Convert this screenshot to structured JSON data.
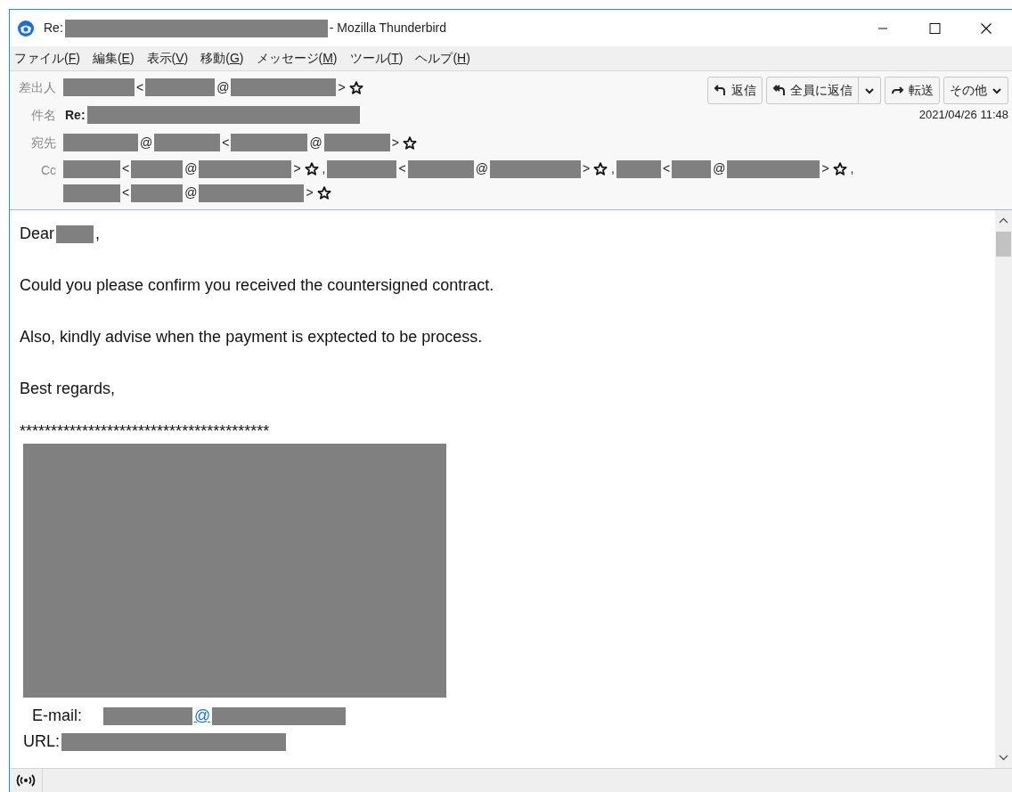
{
  "window": {
    "title": [
      {
        "kind": "text",
        "text": "Re:"
      },
      {
        "kind": "redacted"
      },
      {
        "kind": "text",
        "text": "- Mozilla Thunderbird"
      }
    ]
  },
  "menu": [
    {
      "before": "ファイル(",
      "accesskey": "F",
      "after": ")"
    },
    {
      "before": "編集(",
      "accesskey": "E",
      "after": ")"
    },
    {
      "before": "表示(",
      "accesskey": "V",
      "after": ")"
    },
    {
      "before": "移動(",
      "accesskey": "G",
      "after": ")"
    },
    {
      "before": "メッセージ(",
      "accesskey": "M",
      "after": ")"
    },
    {
      "before": "ツール(",
      "accesskey": "T",
      "after": ")"
    },
    {
      "before": "ヘルプ(",
      "accesskey": "H",
      "after": ")"
    }
  ],
  "header": {
    "toolbar": [
      {
        "kind": "reply",
        "label": "返信"
      },
      {
        "kind": "reply-all",
        "label": "全員に返信",
        "dropdown": true
      },
      {
        "kind": "forward",
        "label": "転送"
      },
      {
        "kind": "more",
        "label": "その他",
        "dropdown": true
      }
    ],
    "date": "2021/04/26 11:48",
    "fields": [
      {
        "label": "差出人",
        "segments": [
          {
            "kind": "redacted"
          },
          {
            "kind": "text",
            "text": "<"
          },
          {
            "kind": "redacted"
          },
          {
            "kind": "text",
            "text": "@"
          },
          {
            "kind": "redacted"
          },
          {
            "kind": "text",
            "text": ">"
          },
          {
            "kind": "star"
          }
        ]
      },
      {
        "label": "件名",
        "segments": [
          {
            "kind": "bold",
            "text": "Re:"
          },
          {
            "kind": "redacted"
          }
        ]
      },
      {
        "label": "宛先",
        "segments": [
          {
            "kind": "redacted"
          },
          {
            "kind": "text",
            "text": "@"
          },
          {
            "kind": "redacted"
          },
          {
            "kind": "text",
            "text": "<"
          },
          {
            "kind": "redacted"
          },
          {
            "kind": "text",
            "text": "@"
          },
          {
            "kind": "redacted"
          },
          {
            "kind": "text",
            "text": ">"
          },
          {
            "kind": "star"
          }
        ]
      },
      {
        "label": "Cc",
        "segments": [
          {
            "kind": "redacted"
          },
          {
            "kind": "text",
            "text": "<"
          },
          {
            "kind": "redacted"
          },
          {
            "kind": "text",
            "text": "@"
          },
          {
            "kind": "redacted"
          },
          {
            "kind": "text",
            "text": ">"
          },
          {
            "kind": "star"
          },
          {
            "kind": "text",
            "text": ","
          },
          {
            "kind": "redacted"
          },
          {
            "kind": "text",
            "text": "<"
          },
          {
            "kind": "redacted"
          },
          {
            "kind": "text",
            "text": "@"
          },
          {
            "kind": "redacted"
          },
          {
            "kind": "text",
            "text": ">"
          },
          {
            "kind": "star"
          },
          {
            "kind": "text",
            "text": ","
          },
          {
            "kind": "redacted"
          },
          {
            "kind": "text",
            "text": "<"
          },
          {
            "kind": "redacted"
          },
          {
            "kind": "text",
            "text": "@"
          },
          {
            "kind": "redacted"
          },
          {
            "kind": "text",
            "text": ">"
          },
          {
            "kind": "star"
          },
          {
            "kind": "text",
            "text": ","
          },
          {
            "kind": "break"
          },
          {
            "kind": "redacted"
          },
          {
            "kind": "text",
            "text": "<"
          },
          {
            "kind": "redacted"
          },
          {
            "kind": "text",
            "text": "@"
          },
          {
            "kind": "redacted"
          },
          {
            "kind": "text",
            "text": ">"
          },
          {
            "kind": "star"
          }
        ]
      }
    ]
  },
  "body": [
    {
      "kind": "line",
      "segments": [
        {
          "kind": "text",
          "text": "Dear"
        },
        {
          "kind": "redacted"
        },
        {
          "kind": "text",
          "text": ","
        }
      ]
    },
    {
      "kind": "line",
      "segments": [
        {
          "kind": "text",
          "text": "Could you please confirm you received the countersigned contract."
        }
      ]
    },
    {
      "kind": "line",
      "segments": [
        {
          "kind": "text",
          "text": "Also, kindly advise when the payment is exptected to be process."
        }
      ]
    },
    {
      "kind": "line",
      "segments": [
        {
          "kind": "text",
          "text": "Best regards,"
        }
      ]
    },
    {
      "kind": "signature",
      "segments": [
        {
          "kind": "text",
          "text": "****************************************"
        }
      ]
    },
    {
      "kind": "block"
    },
    {
      "kind": "sigline",
      "segments": [
        {
          "kind": "text",
          "text": "E-mail:"
        },
        {
          "kind": "redacted"
        },
        {
          "kind": "link",
          "text": "@"
        },
        {
          "kind": "redacted"
        }
      ]
    },
    {
      "kind": "sigline",
      "segments": [
        {
          "kind": "text",
          "text": "URL:"
        },
        {
          "kind": "redacted"
        }
      ]
    }
  ]
}
